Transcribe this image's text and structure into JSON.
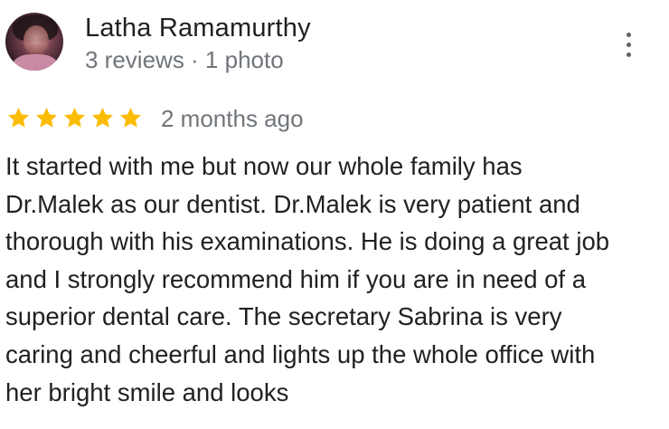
{
  "review": {
    "author": {
      "name": "Latha Ramamurthy",
      "meta": "3 reviews · 1 photo"
    },
    "rating": {
      "stars": 5,
      "max": 5,
      "star_color": "#fbbc04"
    },
    "date": "2 months ago",
    "text_lines": [
      "It started with me but now our whole family has",
      "Dr.Malek as our dentist. Dr.Malek is very patient and",
      "thorough with his examinations. He is doing a great job",
      "and I strongly recommend him if you are in need of a",
      "superior dental care. The secretary Sabrina is very",
      "caring and cheerful and lights up the whole office with",
      "her bright smile and looks"
    ],
    "icons": {
      "more": "more-vert-icon",
      "star": "star-icon"
    }
  }
}
